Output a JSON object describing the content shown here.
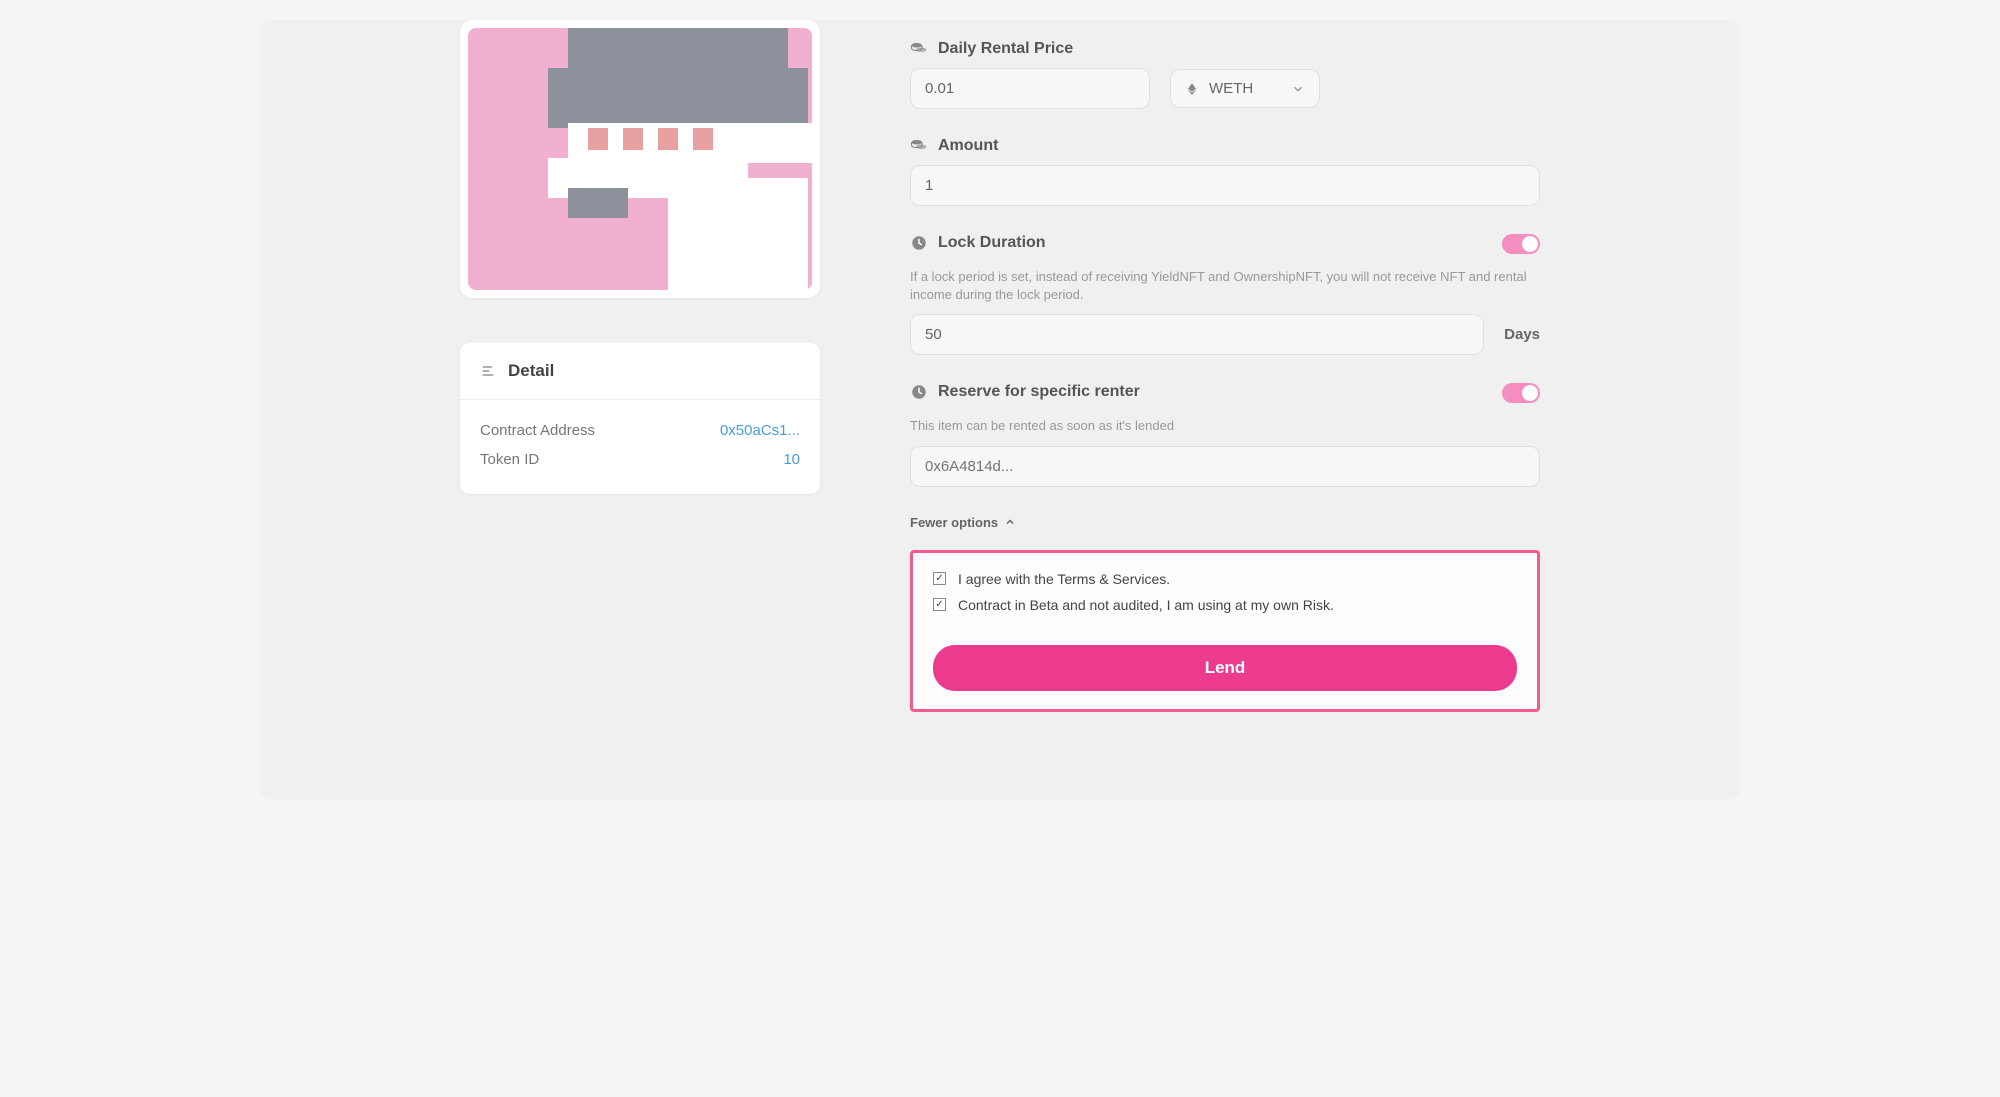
{
  "detail": {
    "title": "Detail",
    "contractAddressLabel": "Contract Address",
    "contractAddressValue": "0x50aCs1...",
    "tokenIdLabel": "Token ID",
    "tokenIdValue": "10"
  },
  "form": {
    "dailyPrice": {
      "label": "Daily Rental Price",
      "value": "0.01",
      "currency": "WETH"
    },
    "amount": {
      "label": "Amount",
      "value": "1"
    },
    "lockDuration": {
      "label": "Lock Duration",
      "description": "If a lock period is set, instead of receiving YieldNFT and OwnershipNFT, you will not receive NFT and rental income during the lock period.",
      "value": "50",
      "unit": "Days"
    },
    "reserve": {
      "label": "Reserve for specific renter",
      "description": "This item can be rented as soon as it's lended",
      "placeholder": "0x6A4814d..."
    },
    "fewerOptionsLabel": "Fewer options",
    "agreeTerms": "I agree with the Terms & Services.",
    "agreeRisk": "Contract in Beta and not audited, I am using at my own Risk.",
    "lendButton": "Lend"
  }
}
